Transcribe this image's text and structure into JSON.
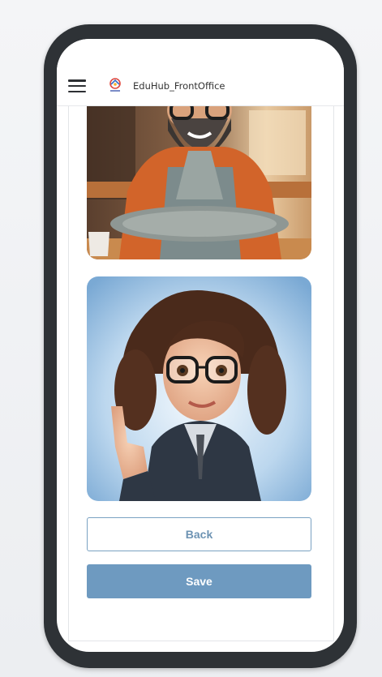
{
  "header": {
    "app_title": "EduHub_FrontOffice",
    "menu_icon": "hamburger-menu-icon",
    "logo_icon": "eduhub-logo-icon"
  },
  "avatars": [
    {
      "name": "bearded-man-avatar",
      "selected": false
    },
    {
      "name": "woman-with-glasses-avatar",
      "selected": false
    }
  ],
  "buttons": {
    "back_label": "Back",
    "save_label": "Save"
  },
  "colors": {
    "primary": "#6e9ac0",
    "back_border": "#7aa2c2",
    "back_text": "#6d93b3",
    "phone_frame": "#2e3236"
  }
}
